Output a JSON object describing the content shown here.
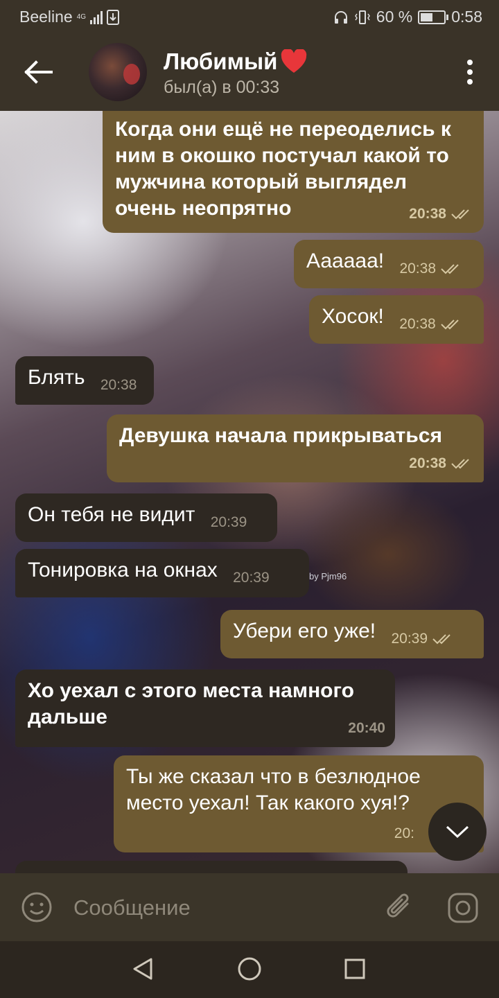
{
  "status_bar": {
    "carrier": "Beeline",
    "network": "4G",
    "battery_percent": "60 %",
    "battery_level": 0.6,
    "time": "0:58"
  },
  "header": {
    "contact_name": "Любимый",
    "status": "был(а) в 00:33",
    "name_emoji_icon": "red-heart-icon",
    "back_icon": "arrow-left-icon",
    "menu_icon": "more-vertical-icon"
  },
  "watermark": "by Pjm96",
  "messages": [
    {
      "direction": "out",
      "text": "Когда они ещё не переоделись к ним в окошко постучал какой то мужчина который выглядел очень неопрятно",
      "time": "20:38",
      "read": true
    },
    {
      "direction": "out",
      "text": "Аааааа!",
      "time": "20:38",
      "read": true
    },
    {
      "direction": "out",
      "text": "Хосок!",
      "time": "20:38",
      "read": true
    },
    {
      "direction": "in",
      "text": "Блять",
      "time": "20:38"
    },
    {
      "direction": "out",
      "text": "Девушка начала прикрываться",
      "time": "20:38",
      "read": true
    },
    {
      "direction": "in",
      "text": "Он тебя не видит",
      "time": "20:39"
    },
    {
      "direction": "in",
      "text": "Тонировка на окнах",
      "time": "20:39"
    },
    {
      "direction": "out",
      "text": "Убери его уже!",
      "time": "20:39",
      "read": true
    },
    {
      "direction": "in",
      "text": "Хо уехал с этого места намного дальше",
      "time": "20:40"
    },
    {
      "direction": "out",
      "text": "Ты же сказал что в безлюдное место уехал! Так какого хуя!?",
      "time": "20:"
    }
  ],
  "input": {
    "placeholder": "Сообщение"
  },
  "colors": {
    "outgoing_bubble": "#6e5a32",
    "incoming_bubble": "#2e2822",
    "header": "#3a3328",
    "read_check": "#d7c9a4"
  }
}
